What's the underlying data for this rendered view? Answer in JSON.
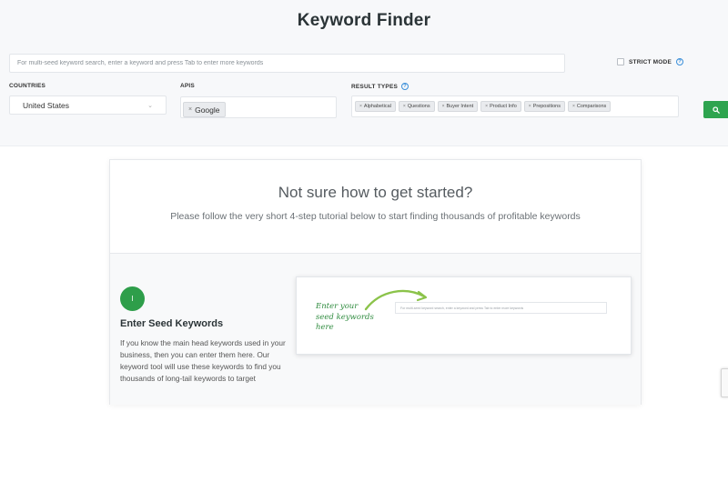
{
  "header": {
    "title": "Keyword Finder"
  },
  "search": {
    "placeholder": "For multi-seed keyword search, enter a keyword and press Tab to enter more keywords"
  },
  "strict_mode": {
    "label": "STRICT MODE",
    "checked": false
  },
  "countries": {
    "label": "COUNTRIES",
    "selected": "United States"
  },
  "apis": {
    "label": "APIS",
    "tags": [
      "Google"
    ]
  },
  "result_types": {
    "label": "RESULT TYPES",
    "tags": [
      "Alphabetical",
      "Questions",
      "Buyer Intent",
      "Product Info",
      "Prepositions",
      "Comparisons"
    ]
  },
  "search_button": {
    "icon": "search-icon"
  },
  "tutorial": {
    "title": "Not sure how to get started?",
    "subtitle": "Please follow the very short 4-step tutorial below to start finding thousands of profitable keywords",
    "step": {
      "number": "I",
      "title": "Enter Seed Keywords",
      "description": "If you know the main head keywords used in your business, then you can enter them here. Our keyword tool will use these keywords to find you thousands of long-tail keywords to target"
    },
    "preview": {
      "input_text": "For multi-seed keyword search, enter a keyword and press Tab to enter more keywords",
      "handwriting": [
        "Enter your",
        "seed keywords",
        "here"
      ]
    }
  },
  "colors": {
    "accent": "#2ea44f",
    "link": "#3b8fd9",
    "handwriting": "#2e8b3e"
  }
}
